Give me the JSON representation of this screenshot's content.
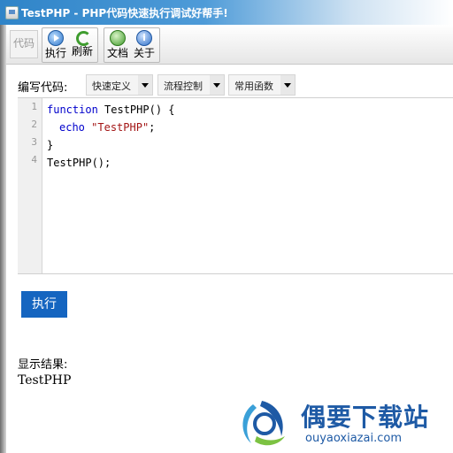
{
  "window": {
    "title": "TestPHP - PHP代码快速执行调试好帮手!"
  },
  "toolbar": {
    "code": "代码",
    "run": "执行",
    "refresh": "刷新",
    "docs": "文档",
    "about": "关于"
  },
  "editor_bar": {
    "label": "编写代码:",
    "dropdowns": [
      "快速定义",
      "流程控制",
      "常用函数"
    ]
  },
  "editor": {
    "line_numbers": [
      "1",
      "2",
      "3",
      "4"
    ],
    "lines": {
      "l1_kw": "function",
      "l1_rest": " TestPHP() {",
      "l2_kw": "echo",
      "l2_str": "\"TestPHP\"",
      "l2_end": ";",
      "l3": "}",
      "l4": "TestPHP();"
    }
  },
  "execute_button": "执行",
  "result": {
    "label": "显示结果:",
    "value": "TestPHP"
  },
  "watermark": {
    "title": "偶要下载站",
    "url": "ouyaoxiazai.com"
  },
  "colors": {
    "title_bar": "#2f84c8",
    "execute_button": "#1565c0",
    "watermark": "#1e5aa5"
  }
}
